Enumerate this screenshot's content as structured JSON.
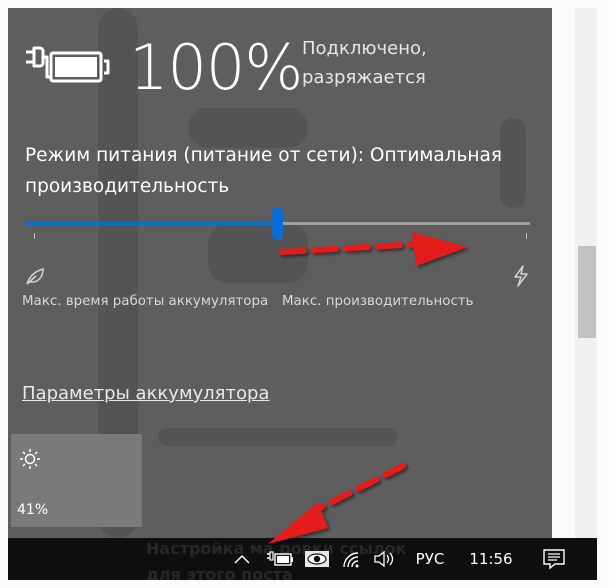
{
  "flyout": {
    "battery_percent": "100%",
    "status_line1": "Подключено,",
    "status_line2": "разряжается",
    "power_mode_title": "Режим питания (питание от сети): Оптимальная производительность",
    "slider_level_percent": 50,
    "slider_left_label": "Макс. время работы аккумулятора",
    "slider_right_label": "Макс. производительность",
    "battery_settings_link": "Параметры аккумулятора",
    "brightness_tile_value": "41%"
  },
  "background_page": {
    "caption_line1": "Настройка ма  ровки ссылок",
    "caption_line2": "для этого поста"
  },
  "taskbar": {
    "show_hidden_icon": "chevron-up-icon",
    "battery_icon": "battery-charging-icon",
    "eye_icon": "eye-icon",
    "wifi_icon": "wifi-icon",
    "volume_icon": "volume-icon",
    "language": "РУС",
    "time": "11:56",
    "notifications_icon": "action-center-icon"
  },
  "colors": {
    "flyout_bg": "#5e5e5e",
    "accent": "#0a6fd4",
    "taskbar_bg": "#0f0f0f",
    "arrow_red": "#e41b1b"
  }
}
